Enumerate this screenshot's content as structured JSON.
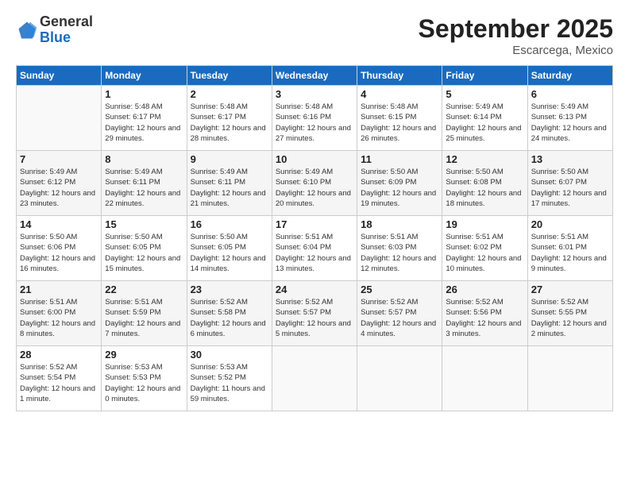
{
  "logo": {
    "general": "General",
    "blue": "Blue"
  },
  "title": "September 2025",
  "subtitle": "Escarcega, Mexico",
  "weekdays": [
    "Sunday",
    "Monday",
    "Tuesday",
    "Wednesday",
    "Thursday",
    "Friday",
    "Saturday"
  ],
  "weeks": [
    [
      {
        "day": "",
        "sunrise": "",
        "sunset": "",
        "daylight": ""
      },
      {
        "day": "1",
        "sunrise": "Sunrise: 5:48 AM",
        "sunset": "Sunset: 6:17 PM",
        "daylight": "Daylight: 12 hours and 29 minutes."
      },
      {
        "day": "2",
        "sunrise": "Sunrise: 5:48 AM",
        "sunset": "Sunset: 6:17 PM",
        "daylight": "Daylight: 12 hours and 28 minutes."
      },
      {
        "day": "3",
        "sunrise": "Sunrise: 5:48 AM",
        "sunset": "Sunset: 6:16 PM",
        "daylight": "Daylight: 12 hours and 27 minutes."
      },
      {
        "day": "4",
        "sunrise": "Sunrise: 5:48 AM",
        "sunset": "Sunset: 6:15 PM",
        "daylight": "Daylight: 12 hours and 26 minutes."
      },
      {
        "day": "5",
        "sunrise": "Sunrise: 5:49 AM",
        "sunset": "Sunset: 6:14 PM",
        "daylight": "Daylight: 12 hours and 25 minutes."
      },
      {
        "day": "6",
        "sunrise": "Sunrise: 5:49 AM",
        "sunset": "Sunset: 6:13 PM",
        "daylight": "Daylight: 12 hours and 24 minutes."
      }
    ],
    [
      {
        "day": "7",
        "sunrise": "Sunrise: 5:49 AM",
        "sunset": "Sunset: 6:12 PM",
        "daylight": "Daylight: 12 hours and 23 minutes."
      },
      {
        "day": "8",
        "sunrise": "Sunrise: 5:49 AM",
        "sunset": "Sunset: 6:11 PM",
        "daylight": "Daylight: 12 hours and 22 minutes."
      },
      {
        "day": "9",
        "sunrise": "Sunrise: 5:49 AM",
        "sunset": "Sunset: 6:11 PM",
        "daylight": "Daylight: 12 hours and 21 minutes."
      },
      {
        "day": "10",
        "sunrise": "Sunrise: 5:49 AM",
        "sunset": "Sunset: 6:10 PM",
        "daylight": "Daylight: 12 hours and 20 minutes."
      },
      {
        "day": "11",
        "sunrise": "Sunrise: 5:50 AM",
        "sunset": "Sunset: 6:09 PM",
        "daylight": "Daylight: 12 hours and 19 minutes."
      },
      {
        "day": "12",
        "sunrise": "Sunrise: 5:50 AM",
        "sunset": "Sunset: 6:08 PM",
        "daylight": "Daylight: 12 hours and 18 minutes."
      },
      {
        "day": "13",
        "sunrise": "Sunrise: 5:50 AM",
        "sunset": "Sunset: 6:07 PM",
        "daylight": "Daylight: 12 hours and 17 minutes."
      }
    ],
    [
      {
        "day": "14",
        "sunrise": "Sunrise: 5:50 AM",
        "sunset": "Sunset: 6:06 PM",
        "daylight": "Daylight: 12 hours and 16 minutes."
      },
      {
        "day": "15",
        "sunrise": "Sunrise: 5:50 AM",
        "sunset": "Sunset: 6:05 PM",
        "daylight": "Daylight: 12 hours and 15 minutes."
      },
      {
        "day": "16",
        "sunrise": "Sunrise: 5:50 AM",
        "sunset": "Sunset: 6:05 PM",
        "daylight": "Daylight: 12 hours and 14 minutes."
      },
      {
        "day": "17",
        "sunrise": "Sunrise: 5:51 AM",
        "sunset": "Sunset: 6:04 PM",
        "daylight": "Daylight: 12 hours and 13 minutes."
      },
      {
        "day": "18",
        "sunrise": "Sunrise: 5:51 AM",
        "sunset": "Sunset: 6:03 PM",
        "daylight": "Daylight: 12 hours and 12 minutes."
      },
      {
        "day": "19",
        "sunrise": "Sunrise: 5:51 AM",
        "sunset": "Sunset: 6:02 PM",
        "daylight": "Daylight: 12 hours and 10 minutes."
      },
      {
        "day": "20",
        "sunrise": "Sunrise: 5:51 AM",
        "sunset": "Sunset: 6:01 PM",
        "daylight": "Daylight: 12 hours and 9 minutes."
      }
    ],
    [
      {
        "day": "21",
        "sunrise": "Sunrise: 5:51 AM",
        "sunset": "Sunset: 6:00 PM",
        "daylight": "Daylight: 12 hours and 8 minutes."
      },
      {
        "day": "22",
        "sunrise": "Sunrise: 5:51 AM",
        "sunset": "Sunset: 5:59 PM",
        "daylight": "Daylight: 12 hours and 7 minutes."
      },
      {
        "day": "23",
        "sunrise": "Sunrise: 5:52 AM",
        "sunset": "Sunset: 5:58 PM",
        "daylight": "Daylight: 12 hours and 6 minutes."
      },
      {
        "day": "24",
        "sunrise": "Sunrise: 5:52 AM",
        "sunset": "Sunset: 5:57 PM",
        "daylight": "Daylight: 12 hours and 5 minutes."
      },
      {
        "day": "25",
        "sunrise": "Sunrise: 5:52 AM",
        "sunset": "Sunset: 5:57 PM",
        "daylight": "Daylight: 12 hours and 4 minutes."
      },
      {
        "day": "26",
        "sunrise": "Sunrise: 5:52 AM",
        "sunset": "Sunset: 5:56 PM",
        "daylight": "Daylight: 12 hours and 3 minutes."
      },
      {
        "day": "27",
        "sunrise": "Sunrise: 5:52 AM",
        "sunset": "Sunset: 5:55 PM",
        "daylight": "Daylight: 12 hours and 2 minutes."
      }
    ],
    [
      {
        "day": "28",
        "sunrise": "Sunrise: 5:52 AM",
        "sunset": "Sunset: 5:54 PM",
        "daylight": "Daylight: 12 hours and 1 minute."
      },
      {
        "day": "29",
        "sunrise": "Sunrise: 5:53 AM",
        "sunset": "Sunset: 5:53 PM",
        "daylight": "Daylight: 12 hours and 0 minutes."
      },
      {
        "day": "30",
        "sunrise": "Sunrise: 5:53 AM",
        "sunset": "Sunset: 5:52 PM",
        "daylight": "Daylight: 11 hours and 59 minutes."
      },
      {
        "day": "",
        "sunrise": "",
        "sunset": "",
        "daylight": ""
      },
      {
        "day": "",
        "sunrise": "",
        "sunset": "",
        "daylight": ""
      },
      {
        "day": "",
        "sunrise": "",
        "sunset": "",
        "daylight": ""
      },
      {
        "day": "",
        "sunrise": "",
        "sunset": "",
        "daylight": ""
      }
    ]
  ]
}
